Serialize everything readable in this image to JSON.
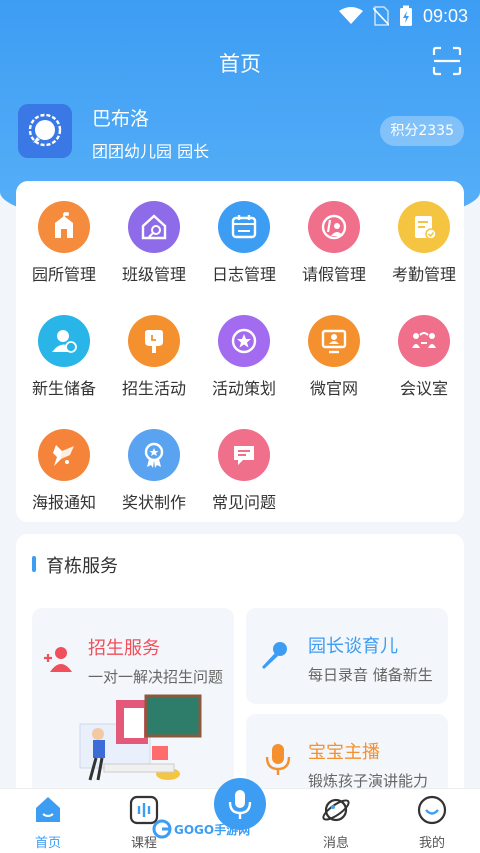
{
  "status": {
    "time": "09:03"
  },
  "header": {
    "title": "首页"
  },
  "profile": {
    "name": "巴布洛",
    "org": "团团幼儿园  园长",
    "points": "积分2335"
  },
  "menu": [
    {
      "label": "园所管理",
      "icon": "school-icon",
      "color": "#f58b3c"
    },
    {
      "label": "班级管理",
      "icon": "class-house-icon",
      "color": "#8e6be8"
    },
    {
      "label": "日志管理",
      "icon": "calendar-icon",
      "color": "#3d9df3"
    },
    {
      "label": "请假管理",
      "icon": "leave-icon",
      "color": "#f06f8b"
    },
    {
      "label": "考勤管理",
      "icon": "attendance-icon",
      "color": "#f5c542"
    },
    {
      "label": "新生储备",
      "icon": "new-student-icon",
      "color": "#29b5e8"
    },
    {
      "label": "招生活动",
      "icon": "recruit-activity-icon",
      "color": "#f5902f"
    },
    {
      "label": "活动策划",
      "icon": "star-badge-icon",
      "color": "#a36cf0"
    },
    {
      "label": "微官网",
      "icon": "monitor-icon",
      "color": "#f5902f"
    },
    {
      "label": "会议室",
      "icon": "meeting-room-icon",
      "color": "#f06f8b"
    },
    {
      "label": "海报通知",
      "icon": "poster-icon",
      "color": "#f5843a"
    },
    {
      "label": "奖状制作",
      "icon": "award-icon",
      "color": "#5aa3f0"
    },
    {
      "label": "常见问题",
      "icon": "faq-icon",
      "color": "#f06f8b"
    }
  ],
  "services": {
    "section_title": "育栋服务",
    "items": [
      {
        "title": "招生服务",
        "subtitle": "一对一解决招生问题",
        "icon": "add-person-icon",
        "color": "#f04f5c"
      },
      {
        "title": "园长谈育儿",
        "subtitle": "每日录音 储备新生",
        "icon": "microphone-icon",
        "color": "#3d9df3"
      },
      {
        "title": "宝宝主播",
        "subtitle": "锻炼孩子演讲能力",
        "icon": "podcast-mic-icon",
        "color": "#f5902f"
      }
    ]
  },
  "tabbar": [
    {
      "label": "首页",
      "icon": "home-icon"
    },
    {
      "label": "课程",
      "icon": "audio-course-icon"
    },
    {
      "label": "消息",
      "icon": "planet-message-icon"
    },
    {
      "label": "我的",
      "icon": "profile-smile-icon"
    }
  ],
  "watermark": {
    "text": "GOGO手游网"
  },
  "colors": {
    "primary": "#3d9df3",
    "background": "#f2f5f9"
  }
}
